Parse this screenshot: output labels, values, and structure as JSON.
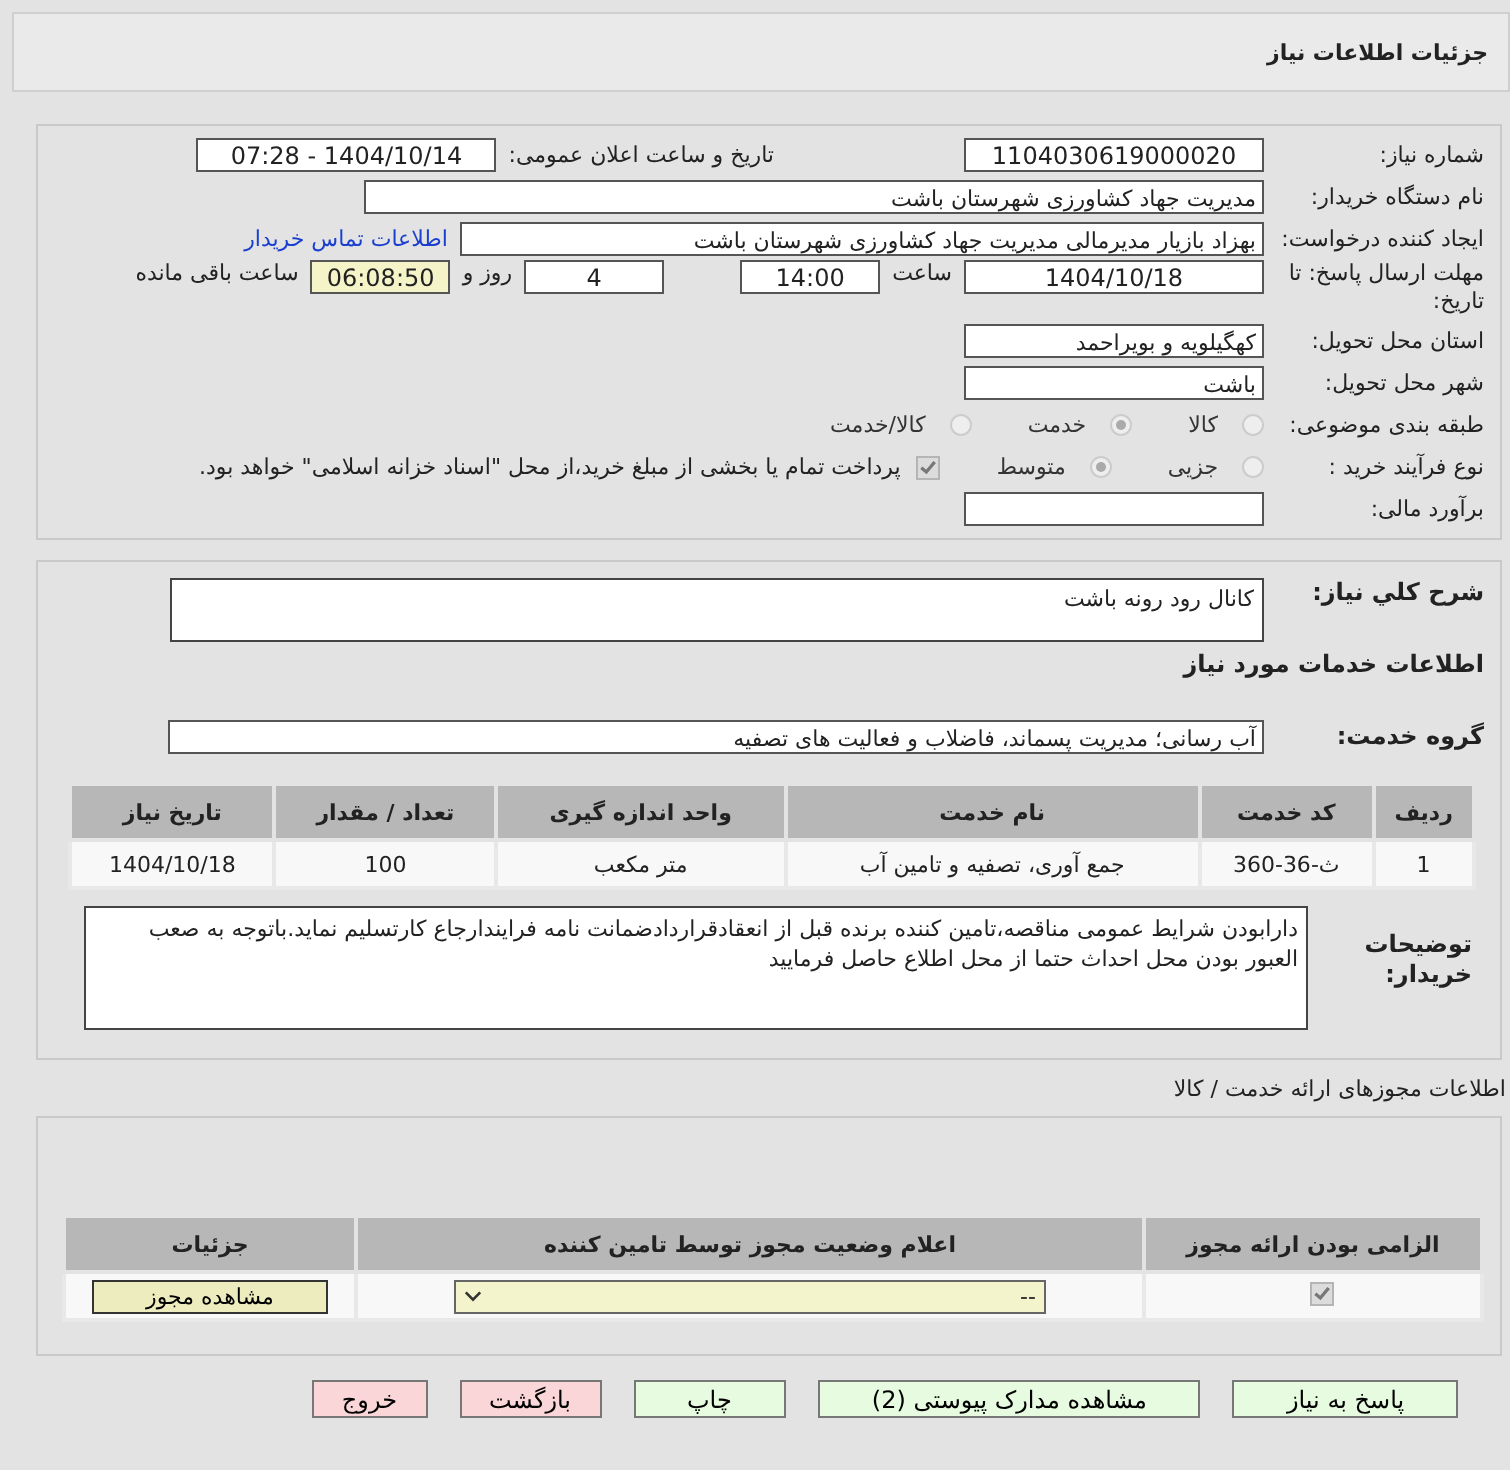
{
  "title": "جزئیات اطلاعات نیاز",
  "need_number": {
    "label": "شماره نیاز:",
    "value": "1104030619000020"
  },
  "announce": {
    "label": "تاریخ و ساعت اعلان عمومی:",
    "value": "1404/10/14 - 07:28"
  },
  "buyer": {
    "label": "نام دستگاه خریدار:",
    "value": "مدیریت جهاد کشاورزی شهرستان باشت"
  },
  "creator": {
    "label": "ایجاد کننده درخواست:",
    "value": "بهزاد بازیار مدیرمالی مدیریت جهاد کشاورزی شهرستان باشت",
    "link": "اطلاعات تماس خریدار"
  },
  "deadline": {
    "label": "مهلت ارسال پاسخ: تا تاریخ:",
    "date": "1404/10/18",
    "time_label": "ساعت",
    "time": "14:00",
    "days": "4",
    "days_label": "روز و",
    "remaining": "06:08:50",
    "remaining_label": "ساعت باقی مانده"
  },
  "province": {
    "label": "استان محل تحویل:",
    "value": "کهگیلویه و بویراحمد"
  },
  "city": {
    "label": "شهر محل تحویل:",
    "value": "باشت"
  },
  "category": {
    "label": "طبقه بندی موضوعی:",
    "options": [
      {
        "label": "کالا",
        "selected": false
      },
      {
        "label": "خدمت",
        "selected": true
      },
      {
        "label": "کالا/خدمت",
        "selected": false
      }
    ]
  },
  "process": {
    "label": "نوع فرآیند خرید :",
    "options": [
      {
        "label": "جزیی",
        "selected": false
      },
      {
        "label": "متوسط",
        "selected": true
      }
    ],
    "payment": {
      "label": "پرداخت تمام یا بخشی از مبلغ خرید،از محل \"اسناد خزانه اسلامی\" خواهد بود.",
      "checked": true
    }
  },
  "estimate": {
    "label": "برآورد مالی:"
  },
  "description": {
    "label": "شرح كلي نياز:",
    "value": "كانال رود رونه باشت"
  },
  "services_heading": "اطلاعات خدمات مورد نیاز",
  "service_group": {
    "label": "گروه خدمت:",
    "value": "آب رسانی؛ مدیریت پسماند، فاضلاب و فعالیت های تصفیه"
  },
  "table": {
    "columns": [
      "ردیف",
      "کد خدمت",
      "نام خدمت",
      "واحد اندازه گیری",
      "تعداد / مقدار",
      "تاریخ نیاز"
    ],
    "rows": [
      [
        "1",
        "ث-36-360",
        "جمع آوری، تصفیه و تامین آب",
        "متر مکعب",
        "100",
        "1404/10/18"
      ]
    ]
  },
  "buyer_notes": {
    "label": "توضیحات خریدار:",
    "value": "دارابودن شرایط عمومی مناقصه،تامین کننده برنده قبل از انعقادقراردادضمانت نامه فرایندارجاع کارتسلیم نماید.باتوجه به صعب العبور بودن محل احداث حتما از محل اطلاع حاصل فرمایید"
  },
  "permits": {
    "heading": "اطلاعات مجوزهای ارائه خدمت / کالا",
    "columns": [
      "الزامی بودن ارائه مجوز",
      "اعلام وضعیت مجوز توسط تامین کننده",
      "جزئیات"
    ],
    "rows": [
      {
        "required": true,
        "status": "--",
        "action": "مشاهده مجوز"
      }
    ]
  },
  "buttons": [
    {
      "label": "پاسخ به نیاز",
      "kind": "normal"
    },
    {
      "label": "مشاهده مدارک پیوستی (2)",
      "kind": "normal"
    },
    {
      "label": "چاپ",
      "kind": "normal"
    },
    {
      "label": "بازگشت",
      "kind": "exit"
    },
    {
      "label": "خروج",
      "kind": "exit"
    }
  ]
}
